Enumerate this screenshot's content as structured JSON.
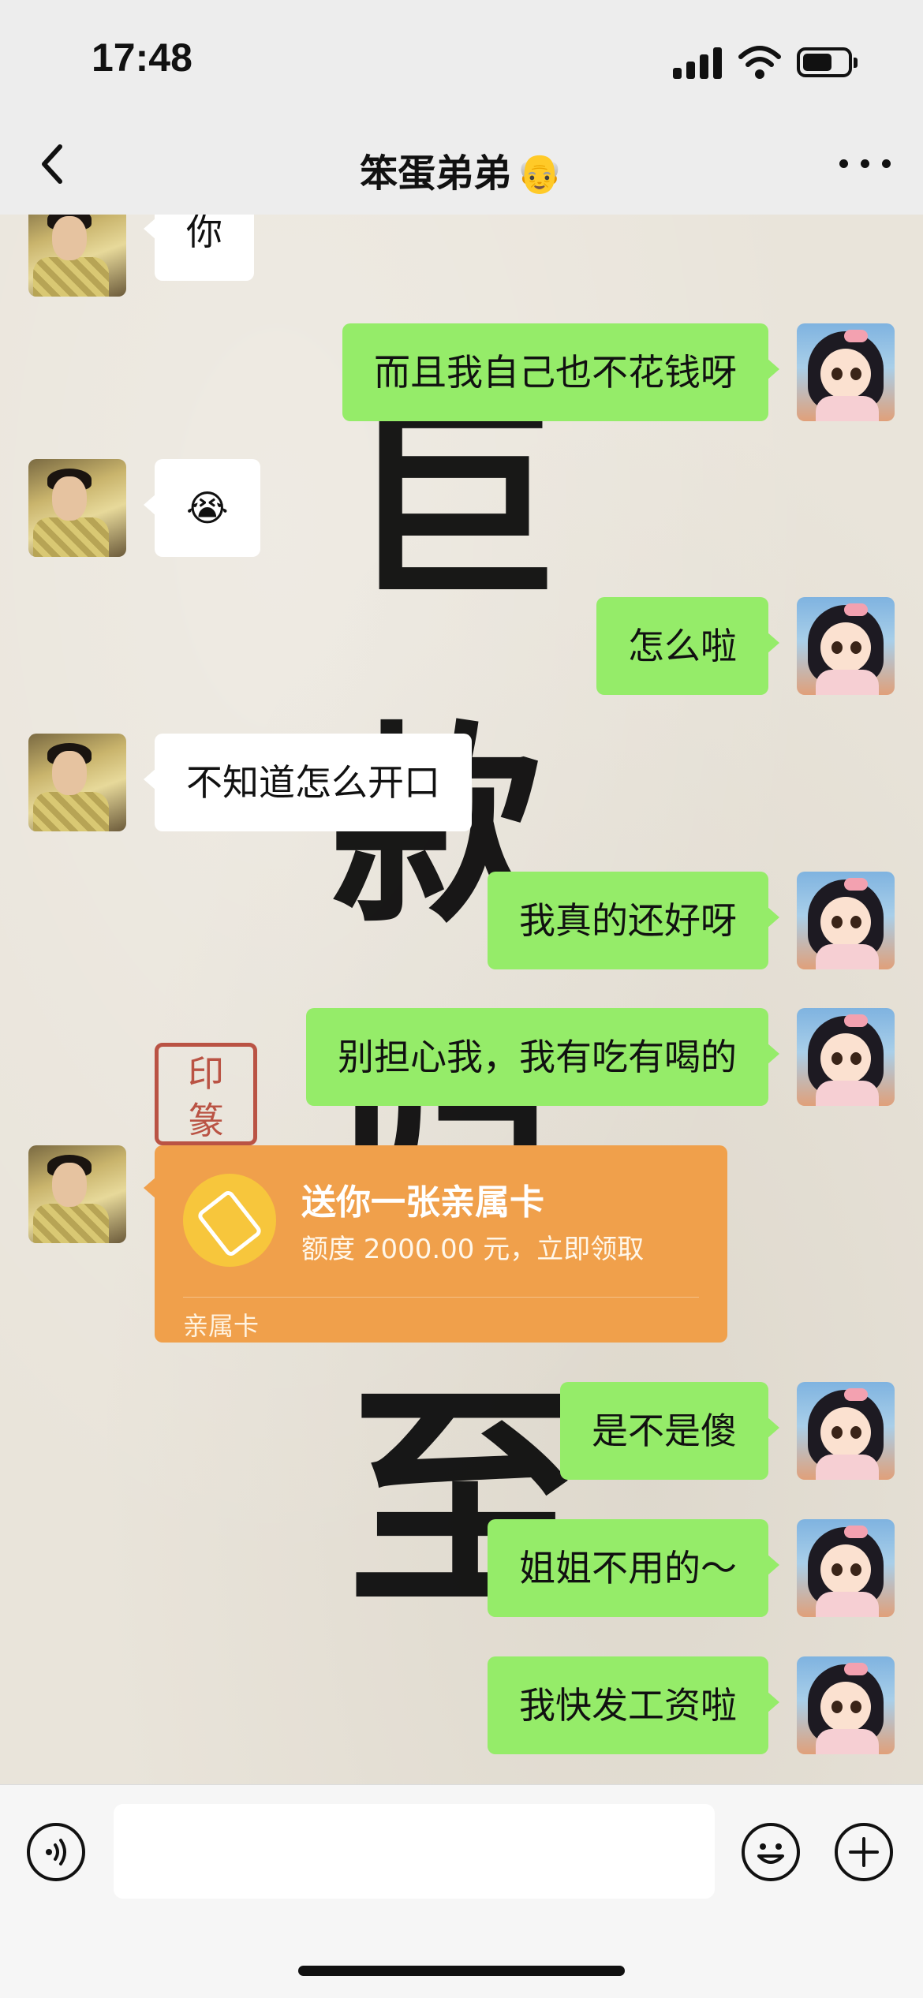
{
  "status_bar": {
    "time": "17:48"
  },
  "header": {
    "title": "笨蛋弟弟",
    "title_emoji": "👴"
  },
  "background": {
    "calligraphy": [
      "巨",
      "款",
      "归",
      "至"
    ]
  },
  "messages": [
    {
      "side": "left",
      "text": "你"
    },
    {
      "side": "right",
      "text": "而且我自己也不花钱呀"
    },
    {
      "side": "left",
      "text": "😭"
    },
    {
      "side": "right",
      "text": "怎么啦"
    },
    {
      "side": "left",
      "text": "不知道怎么开口"
    },
    {
      "side": "right",
      "text": "我真的还好呀"
    },
    {
      "side": "right",
      "text": "别担心我，我有吃有喝的"
    },
    {
      "side": "right",
      "text": "是不是傻"
    },
    {
      "side": "right",
      "text": "姐姐不用的～"
    },
    {
      "side": "right",
      "text": "我快发工资啦"
    }
  ],
  "card": {
    "title": "送你一张亲属卡",
    "subtitle": "额度 2000.00 元，立即领取",
    "footer": "亲属卡",
    "color": "#f0a04b"
  },
  "colors": {
    "sent_bubble": "#95ec69",
    "received_bubble": "#ffffff"
  }
}
